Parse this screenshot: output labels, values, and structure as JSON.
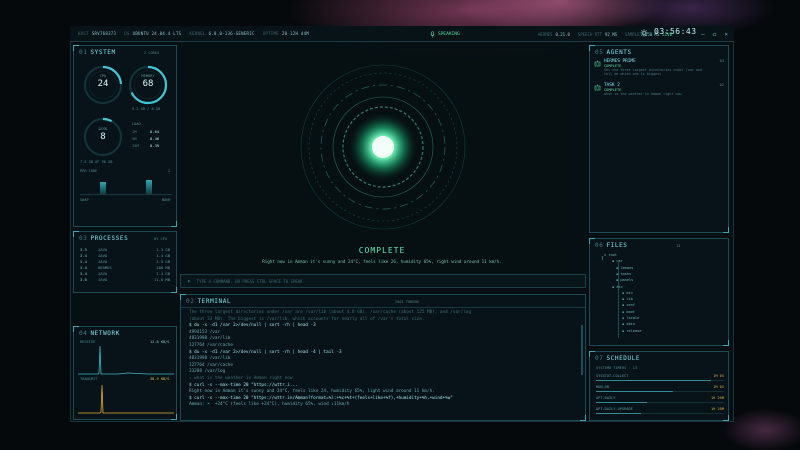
{
  "topbar": {
    "host_label": "HOST",
    "host": "SRV768373",
    "os_label": "OS",
    "os": "UBUNTU 24.04.4 LTS",
    "kernel_label": "KERNEL",
    "kernel": "6.8.0-136-GENERIC",
    "uptime_label": "UPTIME",
    "uptime": "20 12H 44M",
    "speaking": "SPEAKING",
    "hermes_label": "HERMES",
    "hermes": "0.21.0",
    "speed_label": "SPEECH RTT",
    "speed": "92 MS",
    "sample_label": "SAMPLE",
    "sample": "1258 MS",
    "live": "LIVE",
    "clock": "03:56:43",
    "win_minimize": "—",
    "win_restore": "◻",
    "win_close": "✕"
  },
  "system": {
    "num": "01",
    "title": "SYSTEM",
    "cores": "2 CORES",
    "cpu_label": "CPU",
    "cpu": "24",
    "memory_label": "MEMORY",
    "memory": "68",
    "mem_detail": "5.2 GB / 8 GB",
    "disk_label": "DISK",
    "disk": "8",
    "disk_detail": "7.5 GB OF 96 GB",
    "load_label": "LOAD",
    "load": [
      {
        "k": "1M",
        "v": "0.64"
      },
      {
        "k": "5M",
        "v": "0.46"
      },
      {
        "k": "15M",
        "v": "0.39"
      }
    ],
    "per_core_label": "PER CORE",
    "per_core_count": "2",
    "swap_label": "SWAP",
    "swap_value": "NONE"
  },
  "processes": {
    "num": "03",
    "title": "PROCESSES",
    "sort": "BY CPU",
    "rows": [
      {
        "pid": "3.5",
        "name": "JAVA",
        "mem": "1.3 GB"
      },
      {
        "pid": "3.4",
        "name": "JAVA",
        "mem": "1.4 GB"
      },
      {
        "pid": "3.4",
        "name": "JAVA",
        "mem": "1.5 GB"
      },
      {
        "pid": "3.4",
        "name": "HERMES",
        "mem": "280 MB"
      },
      {
        "pid": "3.4",
        "name": "JAVA",
        "mem": "1.4 GB"
      },
      {
        "pid": "3.0",
        "name": "JAVA",
        "mem": "11.8 MB"
      }
    ]
  },
  "network": {
    "num": "04",
    "title": "NETWORK",
    "receive_label": "RECEIVE",
    "receive": "12.8 KB/S",
    "transmit_label": "TRANSMIT",
    "transmit": "38.9 KB/S"
  },
  "core": {
    "status": "COMPLETE",
    "message": "Right now in Amman it's sunny and 24°C, feels like 26, humidity 65%, right wind around 11 km/h."
  },
  "command": {
    "placeholder": "TYPE A COMMAND, OR PRESS CTRL SPACE TO SPEAK"
  },
  "terminal": {
    "num": "02",
    "title": "TERMINAL",
    "tag": "2001 TOKENS",
    "lines": [
      {
        "cls": "c-dim",
        "text": "The three largest directories under /var are /var/lib (about 4.8 GB), /var/cache (about 125 MB), and /var/log"
      },
      {
        "cls": "c-dim",
        "text": "(about 33 MB). The biggest is /var/lib, which accounts for nearly all of /var's total size."
      },
      {
        "cls": "c-cmd",
        "text": "$ du -x -d1 /var 2>/dev/null | sort -rh | head -3"
      },
      {
        "cls": "c-out",
        "text": "4994153 /var"
      },
      {
        "cls": "c-out",
        "text": "4831998 /var/lib"
      },
      {
        "cls": "c-out",
        "text": "127764 /var/cache"
      },
      {
        "cls": "c-cmd",
        "text": "$ du -x -d1 /var 2>/dev/null | sort -rh | head -4 | tail -3"
      },
      {
        "cls": "c-out",
        "text": "4831998 /var/lib"
      },
      {
        "cls": "c-out",
        "text": "127764 /var/cache"
      },
      {
        "cls": "c-out",
        "text": "33288 /var/log"
      },
      {
        "cls": "c-dim",
        "text": "› what is the weather in Amman right now"
      },
      {
        "cls": "c-cmd",
        "text": "$ curl -s --max-time 20 \"https://wttr.i..."
      },
      {
        "cls": "c-out",
        "text": "Right now in Amman it's sunny and 24°C, feels like 24, humidity 65%, light wind around 11 km/h."
      },
      {
        "cls": "c-cmd",
        "text": "$ curl -s --max-time 20 \"https://wttr.in/Amman?format=%l:+%c+%t+(feels+like+%f),+humidity+%h,+wind+%w\""
      },
      {
        "cls": "c-out",
        "text": "Amman: ☀  +24°C (feels like +24°C), humidity 65%, wind ↓11km/h"
      }
    ]
  },
  "agents": {
    "num": "05",
    "title": "AGENTS",
    "items": [
      {
        "name": "HERMES PRIME",
        "state": "COMPLETE",
        "desc": "Get the three largest directories under /var and tell me which one is biggest",
        "num": "03"
      },
      {
        "name": "TASK 2",
        "state": "COMPLETE",
        "desc": "what is the weather in Amman right now",
        "num": "02"
      }
    ]
  },
  "files": {
    "num": "06",
    "title": "FILES",
    "count": "13",
    "tree": [
      "root",
      "usr",
      "lemans",
      "tasks",
      "panels",
      "etc",
      "bin",
      "lib",
      "conf",
      "boot",
      "locale",
      "sbin",
      "release"
    ]
  },
  "schedule": {
    "num": "07",
    "title": "SCHEDULE",
    "header": "SYSTEMD TIMERS · 13",
    "items": [
      {
        "name": "SYSSTAT-COLLECT",
        "time": "1M 0S",
        "fill": 0.9
      },
      {
        "name": "MAN-DB",
        "time": "1M 0S",
        "fill": 0.6
      },
      {
        "name": "APT-DAILY",
        "time": "1H 20M",
        "fill": 0.4
      },
      {
        "name": "APT-DAILY-UPGRADE",
        "time": "1H 20M",
        "fill": 0.35
      }
    ]
  }
}
